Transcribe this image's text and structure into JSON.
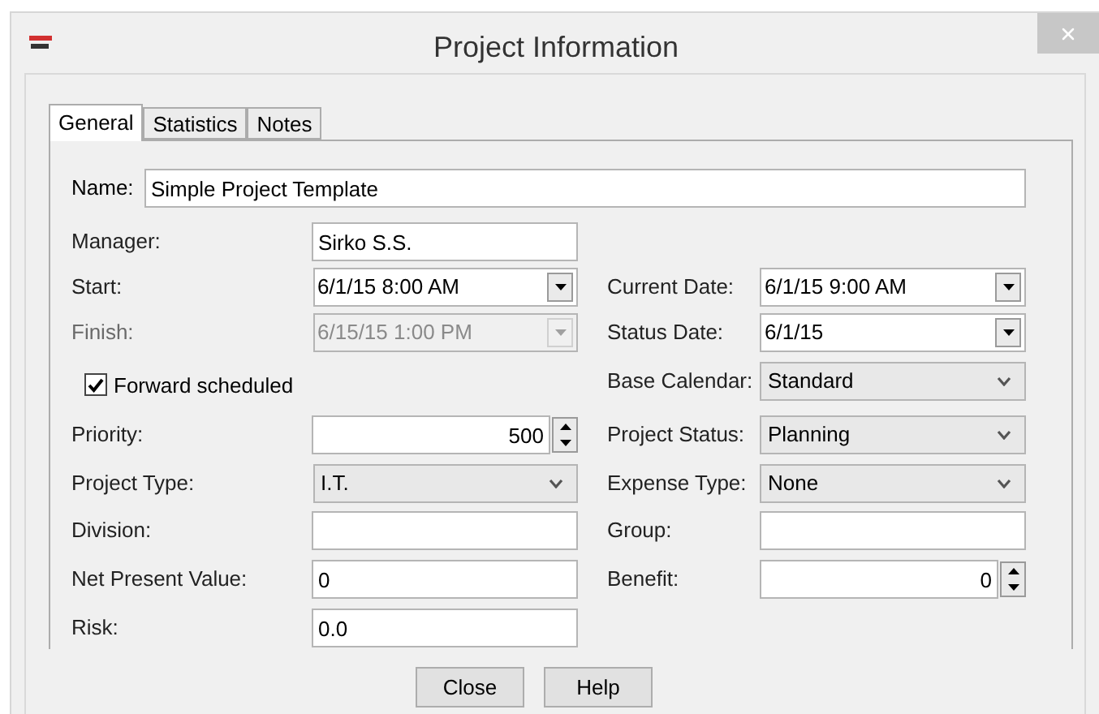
{
  "window": {
    "title": "Project Information"
  },
  "tabs": [
    {
      "label": "General",
      "selected": true
    },
    {
      "label": "Statistics",
      "selected": false
    },
    {
      "label": "Notes",
      "selected": false
    }
  ],
  "name_field": {
    "label": "Name:",
    "value": "Simple Project Template"
  },
  "rows": [
    {
      "cells": [
        {
          "kind": "text",
          "label": "Manager:",
          "value": "Sirko S.S."
        }
      ]
    },
    {
      "cells": [
        {
          "kind": "date",
          "label": "Start:",
          "value": "6/1/15 8:00 AM",
          "disabled": false
        },
        {
          "kind": "date",
          "label": "Current Date:",
          "value": "6/1/15 9:00 AM",
          "disabled": false
        }
      ]
    },
    {
      "cells": [
        {
          "kind": "date",
          "label": "Finish:",
          "value": "6/15/15 1:00 PM",
          "disabled": true
        },
        {
          "kind": "date",
          "label": "Status Date:",
          "value": "6/1/15",
          "disabled": false
        }
      ]
    },
    {
      "cells": [
        {
          "kind": "checkbox",
          "label": "Forward scheduled",
          "checked": true
        },
        {
          "kind": "select",
          "label": "Base Calendar:",
          "value": "Standard"
        }
      ]
    },
    {
      "cells": [
        {
          "kind": "spinner",
          "label": "Priority:",
          "value": "500"
        },
        {
          "kind": "select",
          "label": "Project Status:",
          "value": "Planning"
        }
      ]
    },
    {
      "cells": [
        {
          "kind": "select",
          "label": "Project Type:",
          "value": "I.T."
        },
        {
          "kind": "select",
          "label": "Expense Type:",
          "value": "None"
        }
      ]
    },
    {
      "cells": [
        {
          "kind": "text",
          "label": "Division:"
        },
        {
          "kind": "text",
          "label": "Group:"
        }
      ]
    },
    {
      "cells": [
        {
          "kind": "text",
          "label": "Net Present Value:",
          "value": "0"
        },
        {
          "kind": "spinner",
          "label": "Benefit:",
          "value": "0"
        }
      ]
    },
    {
      "cells": [
        {
          "kind": "text",
          "label": "Risk:",
          "value": "0.0"
        }
      ]
    }
  ],
  "buttons": [
    "Close",
    "Help"
  ]
}
